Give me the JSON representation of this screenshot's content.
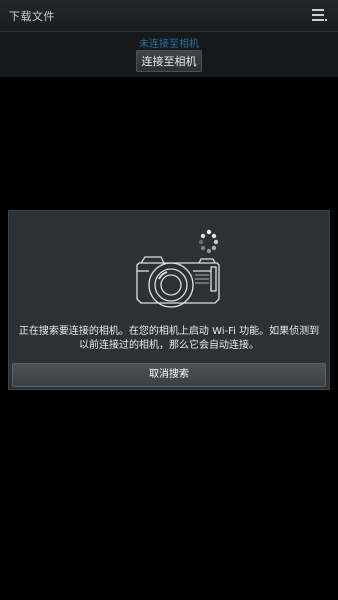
{
  "header": {
    "title": "下载文件",
    "menu_icon": "menu-icon"
  },
  "connection": {
    "status_text": "未连接至相机",
    "connect_button_label": "连接至相机"
  },
  "dialog": {
    "illustration_icon": "camera-wifi-icon",
    "message": "正在搜索要连接的相机。在您的相机上启动 Wi-Fi 功能。如果侦测到以前连接过的相机，那么它会自动连接。",
    "cancel_button_label": "取消搜索"
  },
  "colors": {
    "background": "#000000",
    "dialog_background": "#2b3135",
    "status_text": "#2f6f96"
  }
}
